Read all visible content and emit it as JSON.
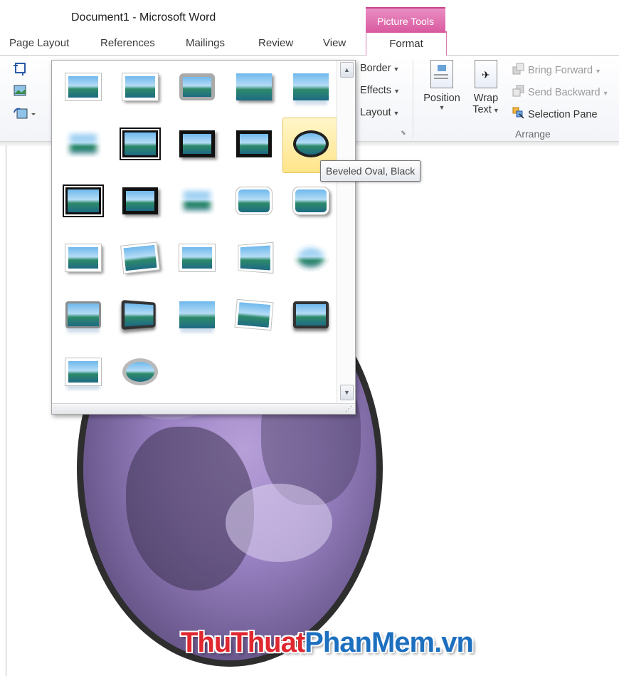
{
  "window": {
    "title": "Document1  -  Microsoft Word",
    "context_tab_header": "Picture Tools"
  },
  "tabs": [
    {
      "label": "Page Layout"
    },
    {
      "label": "References"
    },
    {
      "label": "Mailings"
    },
    {
      "label": "Review"
    },
    {
      "label": "View"
    },
    {
      "label": "Format",
      "active": true
    }
  ],
  "ribbon": {
    "picture_styles_group": {
      "border_label": "Border",
      "effects_label": "Effects",
      "layout_label": "Layout"
    },
    "arrange_group": {
      "position_label": "Position",
      "wrap_label_1": "Wrap",
      "wrap_label_2": "Text",
      "bring_forward_label": "Bring Forward",
      "send_backward_label": "Send Backward",
      "selection_pane_label": "Selection Pane",
      "group_label": "Arrange"
    }
  },
  "gallery": {
    "hovered_index": 9,
    "tooltip": "Beveled Oval, Black",
    "styles": [
      {
        "icon": "simple-frame-white"
      },
      {
        "icon": "beveled-matte-white"
      },
      {
        "icon": "metal-frame"
      },
      {
        "icon": "drop-shadow-rectangle"
      },
      {
        "icon": "reflected-rounded-rectangle"
      },
      {
        "icon": "soft-edge-rectangle"
      },
      {
        "icon": "double-frame-black"
      },
      {
        "icon": "thick-matte-black"
      },
      {
        "icon": "simple-frame-black"
      },
      {
        "icon": "beveled-oval-black"
      },
      {
        "icon": "compound-frame-black"
      },
      {
        "icon": "center-shadow-rectangle"
      },
      {
        "icon": "rounded-diagonal-corner-white"
      },
      {
        "icon": "snip-diagonal-corner-white"
      },
      {
        "icon": "moderate-frame-white"
      },
      {
        "icon": "rotated-white"
      },
      {
        "icon": "perspective-shadow-white"
      },
      {
        "icon": "relaxed-perspective-white"
      },
      {
        "icon": "soft-edge-oval"
      },
      {
        "icon": "bevel-rectangle"
      },
      {
        "icon": "bevel-perspective"
      },
      {
        "icon": "reflected-perspective-right"
      },
      {
        "icon": "bevel-perspective-left-white"
      },
      {
        "icon": "reflected-bevel-black"
      },
      {
        "icon": "reflected-bevel-white"
      },
      {
        "icon": "metal-rounded-rectangle"
      },
      {
        "icon": "metal-oval"
      }
    ]
  },
  "document": {
    "watermark_part1": "ThuThuat",
    "watermark_part2": "PhanMem.vn"
  },
  "colors": {
    "context_tab": "#d9599f",
    "watermark_red": "#e0262f",
    "watermark_blue": "#1d6fbf",
    "picture_tint": "#9b83c4",
    "hover_fill": "#ffe48a"
  }
}
